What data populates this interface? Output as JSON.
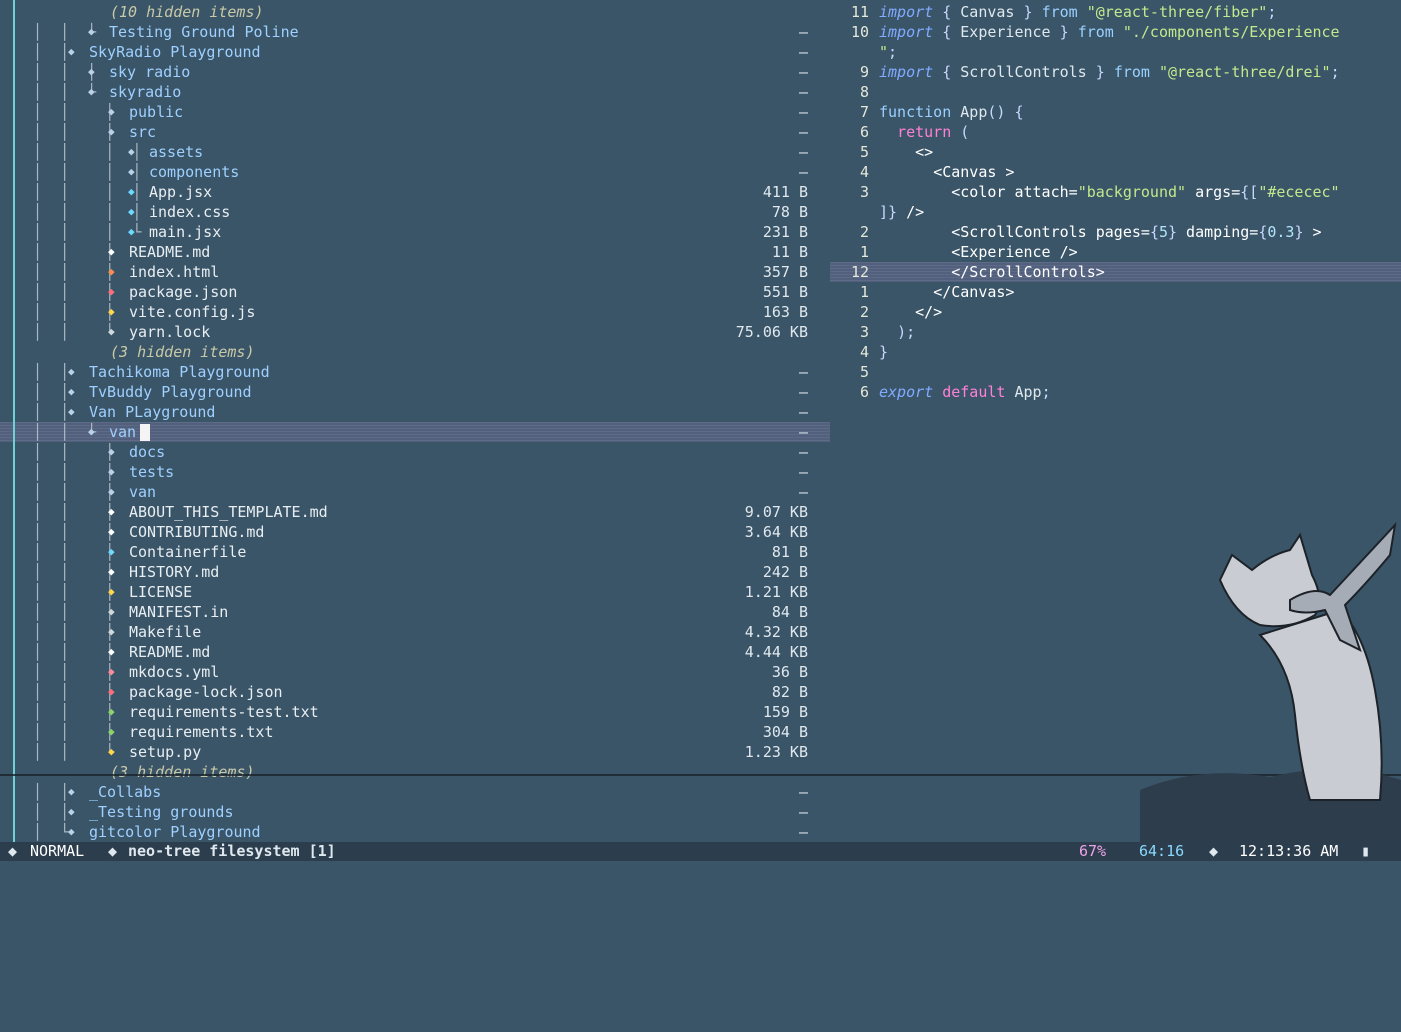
{
  "tree": [
    {
      "guides": "",
      "indent": 110,
      "type": "hidden",
      "name": "(10 hidden items)",
      "size": ""
    },
    {
      "guides": "│  │  └",
      "indent": 90,
      "type": "dir",
      "name": "Testing Ground Poline",
      "size": "–"
    },
    {
      "guides": "│  │",
      "indent": 70,
      "type": "dir",
      "name": "SkyRadio Playground",
      "size": "–"
    },
    {
      "guides": "│  │  │",
      "indent": 90,
      "type": "dir",
      "name": "sky radio",
      "size": "–"
    },
    {
      "guides": "│  │  └",
      "indent": 90,
      "type": "dir",
      "name": "skyradio",
      "size": "–"
    },
    {
      "guides": "│  │    │",
      "indent": 110,
      "type": "dir",
      "name": "public",
      "size": "–"
    },
    {
      "guides": "│  │    │",
      "indent": 110,
      "type": "dir",
      "name": "src",
      "size": "–"
    },
    {
      "guides": "│  │    │  │",
      "indent": 130,
      "type": "dir",
      "name": "assets",
      "size": "–"
    },
    {
      "guides": "│  │    │  │",
      "indent": 130,
      "type": "dir",
      "name": "components",
      "size": "–"
    },
    {
      "guides": "│  │    │  │",
      "indent": 130,
      "type": "file",
      "color": "#6fd8ff",
      "name": "App.jsx",
      "size": "411 B"
    },
    {
      "guides": "│  │    │  │",
      "indent": 130,
      "type": "file",
      "color": "#6fd8ff",
      "name": "index.css",
      "size": "78 B"
    },
    {
      "guides": "│  │    │  └",
      "indent": 130,
      "type": "file",
      "color": "#6fd8ff",
      "name": "main.jsx",
      "size": "231 B"
    },
    {
      "guides": "│  │    │",
      "indent": 110,
      "type": "file",
      "color": "#ffffff",
      "name": "README.md",
      "size": "11 B"
    },
    {
      "guides": "│  │    │",
      "indent": 110,
      "type": "file",
      "color": "#ff8a50",
      "name": "index.html",
      "size": "357 B"
    },
    {
      "guides": "│  │    │",
      "indent": 110,
      "type": "file",
      "color": "#ff6b7a",
      "name": "package.json",
      "size": "551 B"
    },
    {
      "guides": "│  │    │",
      "indent": 110,
      "type": "file",
      "color": "#ffd54a",
      "name": "vite.config.js",
      "size": "163 B"
    },
    {
      "guides": "│  │    └",
      "indent": 110,
      "type": "file",
      "color": "#cfd8dc",
      "name": "yarn.lock",
      "size": "75.06 KB"
    },
    {
      "guides": "",
      "indent": 110,
      "type": "hidden",
      "name": "(3 hidden items)",
      "size": ""
    },
    {
      "guides": "│  │",
      "indent": 70,
      "type": "dir",
      "name": "Tachikoma Playground",
      "size": "–"
    },
    {
      "guides": "│  │",
      "indent": 70,
      "type": "dir",
      "name": "TvBuddy Playground",
      "size": "–"
    },
    {
      "guides": "│  │",
      "indent": 70,
      "type": "dir",
      "name": "Van PLayground",
      "size": "–"
    },
    {
      "guides": "│  │  └",
      "indent": 90,
      "type": "dir",
      "name": "van",
      "size": "–",
      "selected": true
    },
    {
      "guides": "│  │    │",
      "indent": 110,
      "type": "dir",
      "name": "docs",
      "size": "–"
    },
    {
      "guides": "│  │    │",
      "indent": 110,
      "type": "dir",
      "name": "tests",
      "size": "–"
    },
    {
      "guides": "│  │    │",
      "indent": 110,
      "type": "dir",
      "name": "van",
      "size": "–"
    },
    {
      "guides": "│  │    │",
      "indent": 110,
      "type": "file",
      "color": "#ffffff",
      "name": "ABOUT_THIS_TEMPLATE.md",
      "size": "9.07 KB"
    },
    {
      "guides": "│  │    │",
      "indent": 110,
      "type": "file",
      "color": "#ffffff",
      "name": "CONTRIBUTING.md",
      "size": "3.64 KB"
    },
    {
      "guides": "│  │    │",
      "indent": 110,
      "type": "file",
      "color": "#6fd8ff",
      "name": "Containerfile",
      "size": "81 B"
    },
    {
      "guides": "│  │    │",
      "indent": 110,
      "type": "file",
      "color": "#ffffff",
      "name": "HISTORY.md",
      "size": "242 B"
    },
    {
      "guides": "│  │    │",
      "indent": 110,
      "type": "file",
      "color": "#ffd54a",
      "name": "LICENSE",
      "size": "1.21 KB"
    },
    {
      "guides": "│  │    │",
      "indent": 110,
      "type": "file",
      "color": "#cfd8dc",
      "name": "MANIFEST.in",
      "size": "84 B"
    },
    {
      "guides": "│  │    │",
      "indent": 110,
      "type": "file",
      "color": "#cfd8dc",
      "name": "Makefile",
      "size": "4.32 KB"
    },
    {
      "guides": "│  │    │",
      "indent": 110,
      "type": "file",
      "color": "#ffffff",
      "name": "README.md",
      "size": "4.44 KB"
    },
    {
      "guides": "│  │    │",
      "indent": 110,
      "type": "file",
      "color": "#ff8a9a",
      "name": "mkdocs.yml",
      "size": "36 B"
    },
    {
      "guides": "│  │    │",
      "indent": 110,
      "type": "file",
      "color": "#ff6b7a",
      "name": "package-lock.json",
      "size": "82 B"
    },
    {
      "guides": "│  │    │",
      "indent": 110,
      "type": "file",
      "color": "#8bd36a",
      "name": "requirements-test.txt",
      "size": "159 B"
    },
    {
      "guides": "│  │    │",
      "indent": 110,
      "type": "file",
      "color": "#8bd36a",
      "name": "requirements.txt",
      "size": "304 B"
    },
    {
      "guides": "│  │    └",
      "indent": 110,
      "type": "file",
      "color": "#ffd54a",
      "name": "setup.py",
      "size": "1.23 KB"
    },
    {
      "guides": "",
      "indent": 110,
      "type": "hidden",
      "name": "(3 hidden items)",
      "size": ""
    },
    {
      "guides": "│  │",
      "indent": 70,
      "type": "dir",
      "name": "_Collabs",
      "size": "–"
    },
    {
      "guides": "│  │",
      "indent": 70,
      "type": "dir",
      "name": "_Testing grounds",
      "size": "–"
    },
    {
      "guides": "│  └",
      "indent": 70,
      "type": "dir",
      "name": "gitcolor Playground",
      "size": "–"
    }
  ],
  "code": [
    {
      "ln": "11",
      "parts": [
        [
          "kw-i",
          "import"
        ],
        [
          "pun",
          " { "
        ],
        [
          "plain",
          "Canvas"
        ],
        [
          "pun",
          " } "
        ],
        [
          "kw-f",
          "from "
        ],
        [
          "str",
          "\"@react-three/fiber\""
        ],
        [
          "pun",
          ";"
        ]
      ]
    },
    {
      "ln": "10",
      "parts": [
        [
          "kw-i",
          "import"
        ],
        [
          "pun",
          " { "
        ],
        [
          "plain",
          "Experience"
        ],
        [
          "pun",
          " } "
        ],
        [
          "kw-f",
          "from "
        ],
        [
          "str",
          "\"./components/Experience"
        ]
      ]
    },
    {
      "ln": "",
      "parts": [
        [
          "str",
          "\""
        ],
        [
          "pun",
          ";"
        ]
      ]
    },
    {
      "ln": "9",
      "parts": [
        [
          "kw-i",
          "import"
        ],
        [
          "pun",
          " { "
        ],
        [
          "plain",
          "ScrollControls"
        ],
        [
          "pun",
          " } "
        ],
        [
          "kw-f",
          "from "
        ],
        [
          "str",
          "\"@react-three/drei\""
        ],
        [
          "pun",
          ";"
        ]
      ]
    },
    {
      "ln": "8",
      "parts": []
    },
    {
      "ln": "7",
      "parts": [
        [
          "kw-f",
          "function "
        ],
        [
          "plain",
          "App"
        ],
        [
          "pun",
          "() {"
        ]
      ]
    },
    {
      "ln": "6",
      "parts": [
        [
          "plain",
          "  "
        ],
        [
          "kw-r",
          "return"
        ],
        [
          "pun",
          " ("
        ]
      ]
    },
    {
      "ln": "5",
      "parts": [
        [
          "plain",
          "    "
        ],
        [
          "jsx",
          "<>"
        ]
      ]
    },
    {
      "ln": "4",
      "parts": [
        [
          "plain",
          "      "
        ],
        [
          "jsx",
          "<Canvas >"
        ]
      ]
    },
    {
      "ln": "3",
      "parts": [
        [
          "plain",
          "        "
        ],
        [
          "jsx",
          "<color "
        ],
        [
          "attr",
          "attach="
        ],
        [
          "str",
          "\"background\""
        ],
        [
          "attr",
          " args="
        ],
        [
          "pun",
          "{["
        ],
        [
          "str",
          "\"#ececec\""
        ]
      ]
    },
    {
      "ln": "",
      "parts": [
        [
          "pun",
          "]}"
        ],
        [
          "jsx",
          " />"
        ]
      ]
    },
    {
      "ln": "2",
      "parts": [
        [
          "plain",
          "        "
        ],
        [
          "jsx",
          "<ScrollControls "
        ],
        [
          "attr",
          "pages="
        ],
        [
          "pun",
          "{"
        ],
        [
          "num",
          "5"
        ],
        [
          "pun",
          "}"
        ],
        [
          "attr",
          " damping="
        ],
        [
          "pun",
          "{"
        ],
        [
          "num",
          "0.3"
        ],
        [
          "pun",
          "}"
        ],
        [
          "jsx",
          " >"
        ]
      ]
    },
    {
      "ln": "1",
      "parts": [
        [
          "plain",
          "        "
        ],
        [
          "jsx",
          "<Experience />"
        ]
      ]
    },
    {
      "ln": "12",
      "current": true,
      "parts": [
        [
          "plain",
          "        "
        ],
        [
          "jsx",
          "</ScrollControls>"
        ]
      ]
    },
    {
      "ln": "1",
      "parts": [
        [
          "plain",
          "      "
        ],
        [
          "jsx",
          "</Canvas>"
        ]
      ]
    },
    {
      "ln": "2",
      "parts": [
        [
          "plain",
          "    "
        ],
        [
          "jsx",
          "</>"
        ]
      ]
    },
    {
      "ln": "3",
      "parts": [
        [
          "plain",
          "  "
        ],
        [
          "pun",
          ");"
        ]
      ]
    },
    {
      "ln": "4",
      "parts": [
        [
          "pun",
          "}"
        ]
      ]
    },
    {
      "ln": "5",
      "parts": []
    },
    {
      "ln": "6",
      "parts": [
        [
          "kw-i",
          "export "
        ],
        [
          "kw-r",
          "default "
        ],
        [
          "plain",
          "App"
        ],
        [
          "pun",
          ";"
        ]
      ]
    }
  ],
  "status": {
    "mode": "NORMAL",
    "buffer": "neo-tree filesystem [1]",
    "percent": "67%",
    "position": "64:16",
    "time": "12:13:36 AM"
  },
  "icons": {
    "folder": "◆",
    "file": "◆"
  }
}
